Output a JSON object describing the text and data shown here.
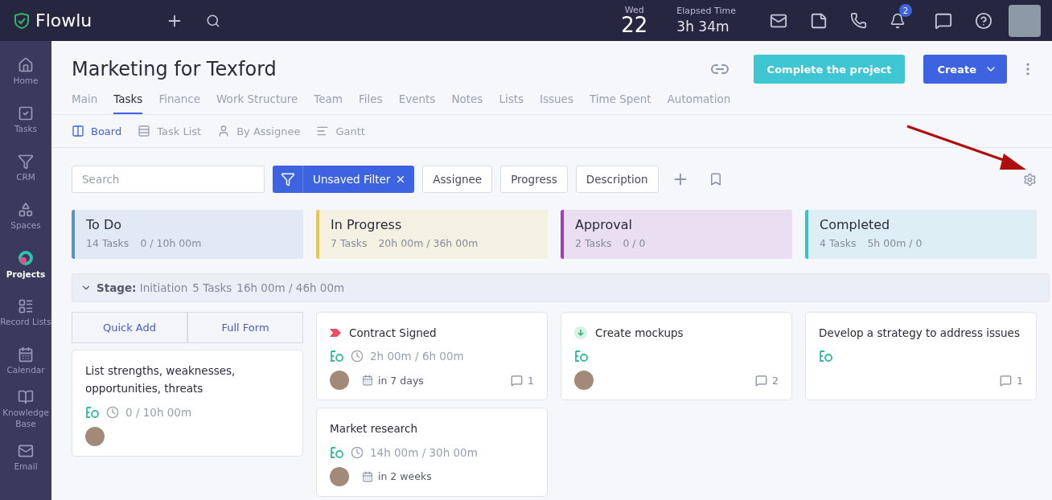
{
  "topbar": {
    "logo": "Flowlu",
    "day": "Wed",
    "date": "22",
    "elapsed_label": "Elapsed Time",
    "elapsed": "3h 34m",
    "notifications": "2"
  },
  "sidebar": {
    "items": [
      {
        "label": "Home",
        "selected": false
      },
      {
        "label": "Tasks",
        "selected": false
      },
      {
        "label": "CRM",
        "selected": false
      },
      {
        "label": "Spaces",
        "selected": false
      },
      {
        "label": "Projects",
        "selected": true
      },
      {
        "label": "Record Lists",
        "selected": false
      },
      {
        "label": "Calendar",
        "selected": false
      },
      {
        "label": "Knowledge Base",
        "selected": false
      },
      {
        "label": "Email",
        "selected": false
      }
    ]
  },
  "project": {
    "title": "Marketing for Texford",
    "complete_button": "Complete the project",
    "create_button": "Create",
    "tabs": [
      {
        "label": "Main",
        "selected": false
      },
      {
        "label": "Tasks",
        "selected": true
      },
      {
        "label": "Finance",
        "selected": false
      },
      {
        "label": "Work Structure",
        "selected": false
      },
      {
        "label": "Team",
        "selected": false
      },
      {
        "label": "Files",
        "selected": false
      },
      {
        "label": "Events",
        "selected": false
      },
      {
        "label": "Notes",
        "selected": false
      },
      {
        "label": "Lists",
        "selected": false
      },
      {
        "label": "Issues",
        "selected": false
      },
      {
        "label": "Time Spent",
        "selected": false
      },
      {
        "label": "Automation",
        "selected": false
      }
    ],
    "views": [
      {
        "kind": "board",
        "label": "Board",
        "selected": true
      },
      {
        "kind": "list",
        "label": "Task List",
        "selected": false
      },
      {
        "kind": "assignee",
        "label": "By Assignee",
        "selected": false
      },
      {
        "kind": "gantt",
        "label": "Gantt",
        "selected": false
      }
    ]
  },
  "filters": {
    "search": {
      "placeholder": "Search"
    },
    "active_filter": "Unsaved Filter",
    "chips": [
      "Assignee",
      "Progress",
      "Description"
    ]
  },
  "stages": [
    {
      "name": "To Do",
      "tasks": "14 Tasks",
      "time": "0 / 10h 00m",
      "color": "#5b8fc7"
    },
    {
      "name": "In Progress",
      "tasks": "7 Tasks",
      "time": "20h 00m / 36h 00m",
      "color": "#ecc84a"
    },
    {
      "name": "Approval",
      "tasks": "2 Tasks",
      "time": "0 / 0",
      "color": "#9b3fb5"
    },
    {
      "name": "Completed",
      "tasks": "4 Tasks",
      "time": "5h 00m / 0",
      "color": "#3bbfc9"
    }
  ],
  "group": {
    "label": "Stage:",
    "value": "Initiation",
    "tasks": "5 Tasks",
    "time": "16h 00m / 46h 00m",
    "expanded": true
  },
  "quick_add": [
    "Quick Add",
    "Full Form"
  ],
  "columns": [
    {
      "cards": [
        {
          "title": "List strengths, weaknesses, opportunities, threats",
          "kind": "plain",
          "time": "0 / 10h 00m",
          "has_avatar": true
        }
      ]
    },
    {
      "cards": [
        {
          "title": "Contract Signed",
          "kind": "high",
          "time": "2h 00m  / 6h 00m",
          "has_avatar": true,
          "due": "in 7 days",
          "comments": "1"
        },
        {
          "title": "Market research",
          "kind": "plain",
          "time": "14h 00m  / 30h 00m",
          "has_avatar": true,
          "due": "in 2 weeks"
        }
      ]
    },
    {
      "cards": [
        {
          "title": "Create mockups",
          "kind": "low",
          "has_avatar": true,
          "comments": "2"
        }
      ]
    },
    {
      "cards": [
        {
          "title": "Develop a strategy to address issues",
          "kind": "plain",
          "has_avatar": false,
          "comments": "1"
        }
      ]
    }
  ]
}
